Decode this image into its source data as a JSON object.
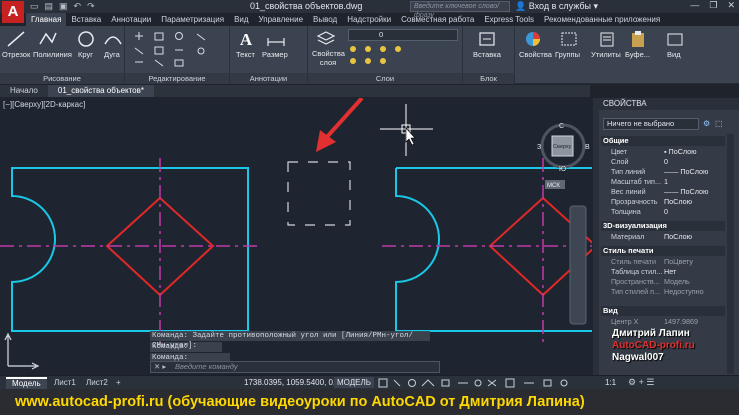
{
  "window": {
    "app_logo": "A",
    "doc_title": "01_свойства объектов.dwg",
    "search_placeholder": "Введите ключевое слово/фразу",
    "signin": "Вход в службы"
  },
  "ribbon_tabs": [
    "Главная",
    "Вставка",
    "Аннотации",
    "Параметризация",
    "Вид",
    "Управление",
    "Вывод",
    "Надстройки",
    "Совместная работа",
    "Express Tools",
    "Рекомендованные приложения"
  ],
  "ribbon": {
    "groups": [
      {
        "label": "Рисование",
        "tools": [
          "Отрезок",
          "Полилиния",
          "Круг",
          "Дуга"
        ]
      },
      {
        "label": "Редактирование",
        "tools": []
      },
      {
        "label": "Аннотации",
        "tools": [
          "Текст",
          "Размер"
        ]
      },
      {
        "label": "Слои",
        "tools": [
          "Свойства слоя"
        ],
        "layer_value": "0"
      },
      {
        "label": "Блок",
        "tools": [
          "Вставка"
        ]
      },
      {
        "label": "",
        "tools": [
          "Свойства",
          "Группы",
          "Утилиты",
          "Буфе...",
          "Вид"
        ]
      }
    ]
  },
  "file_tabs": [
    "Начало",
    "01_свойства объектов*"
  ],
  "viewport": {
    "label": "[−][Сверху][2D-каркас]",
    "viewcube": {
      "n": "С",
      "s": "Ю",
      "w": "З",
      "e": "В",
      "face": "Сверху",
      "ucs": "МСК"
    }
  },
  "command": {
    "history": [
      "Команда: Задайте противоположный угол или [Линия/РМн-угол/СМн-угол]:",
      "Команда:",
      "Команда: *Прервано*"
    ],
    "placeholder": "Введите команду"
  },
  "properties": {
    "title": "СВОЙСТВА",
    "selection": "Ничего не выбрано",
    "sections": [
      {
        "name": "Общие",
        "rows": [
          [
            "Цвет",
            "ПоСлою"
          ],
          [
            "Слой",
            "0"
          ],
          [
            "Тип линий",
            "ПоСлою"
          ],
          [
            "Масштаб тип...",
            "1"
          ],
          [
            "Вес линий",
            "ПоСлою"
          ],
          [
            "Прозрачность",
            "ПоСлою"
          ],
          [
            "Толщина",
            "0"
          ]
        ]
      },
      {
        "name": "3D-визуализация",
        "rows": [
          [
            "Материал",
            "ПоСлою"
          ]
        ]
      },
      {
        "name": "Стиль печати",
        "rows": [
          [
            "Стиль печати",
            "ПоЦвету"
          ],
          [
            "Таблица стил...",
            "Нет"
          ],
          [
            "Пространств...",
            "Модель"
          ],
          [
            "Тип стилей п...",
            "Недоступно"
          ]
        ]
      },
      {
        "name": "Вид",
        "rows": [
          [
            "Центр X",
            "1497.9869"
          ]
        ]
      }
    ]
  },
  "statusbar": {
    "layout_tabs": [
      "Модель",
      "Лист1",
      "Лист2"
    ],
    "coords": "1738.0395, 1059.5400, 0.0000",
    "mode": "МОДЕЛЬ",
    "scale": "1:1"
  },
  "footer": "www.autocad-profi.ru  (обучающие видеоуроки по AutoCAD от Дмитрия Лапина)",
  "watermark": [
    "Дмитрий Лапин",
    "AutoCAD-profi.ru",
    "Nagwal007"
  ],
  "colors": {
    "cyan": "#18c8e6",
    "red": "#e02828",
    "magenta": "#c13aa8",
    "arrow": "#e23030"
  }
}
